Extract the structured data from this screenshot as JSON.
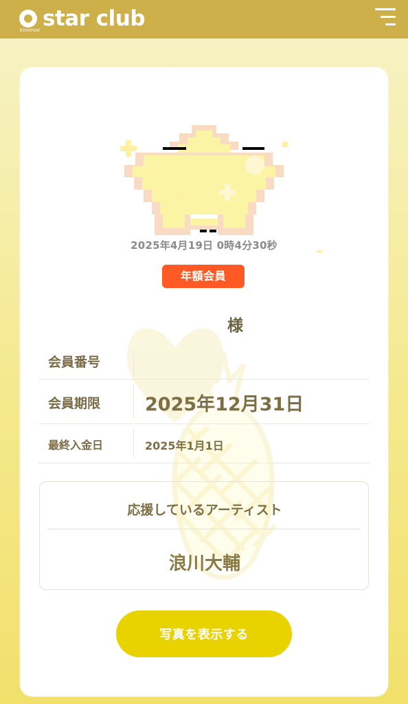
{
  "app": {
    "brand": "star club",
    "subbrand": "kinonoe"
  },
  "member_card": {
    "timestamp": "2025年4月19日 0時4分30秒",
    "membership_badge": "年額会員",
    "honorific": "様",
    "fields": {
      "member_number": {
        "label": "会員番号",
        "value": ""
      },
      "membership_expiry": {
        "label": "会員期限",
        "value": "2025年12月31日"
      },
      "last_payment_date": {
        "label": "最終入金日",
        "value": "2025年1月1日"
      }
    },
    "supporting_artist": {
      "title": "応援しているアーティスト",
      "name": "浪川大輔"
    },
    "show_photo_button": "写真を表示する"
  },
  "colors": {
    "header": "#cdb04a",
    "badge": "#ff5a26",
    "button": "#e8d200",
    "star": "#fbf4a4",
    "star_outline": "#f4d6a5"
  },
  "icons": {
    "menu": "hamburger-menu-icon",
    "logo": "star-club-logo-icon",
    "avatar": "pixel-star-avatar-icon",
    "watermark": "heart-pineapple-watermark-icon"
  }
}
